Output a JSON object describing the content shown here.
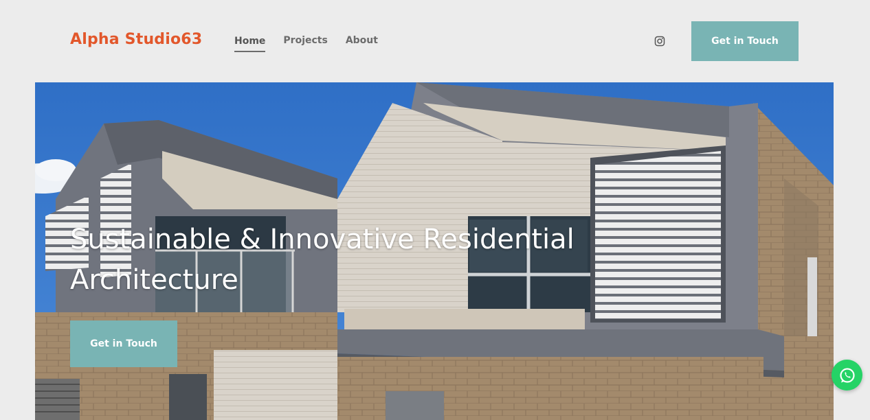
{
  "header": {
    "logo_text": "Alpha Studio63",
    "nav": [
      {
        "label": "Home",
        "active": true
      },
      {
        "label": "Projects",
        "active": false
      },
      {
        "label": "About",
        "active": false
      }
    ],
    "social_icon": "instagram-icon",
    "cta_label": "Get in Touch"
  },
  "hero": {
    "image_alt": "Modern residential house",
    "title": "Sustainable & Innovative Residential Architecture",
    "cta_label": "Get in Touch"
  },
  "floating": {
    "icon": "whatsapp-icon"
  },
  "colors": {
    "brand": "#e2572b",
    "accent": "#79b4b4",
    "background": "#ececec",
    "whatsapp": "#25d366"
  }
}
